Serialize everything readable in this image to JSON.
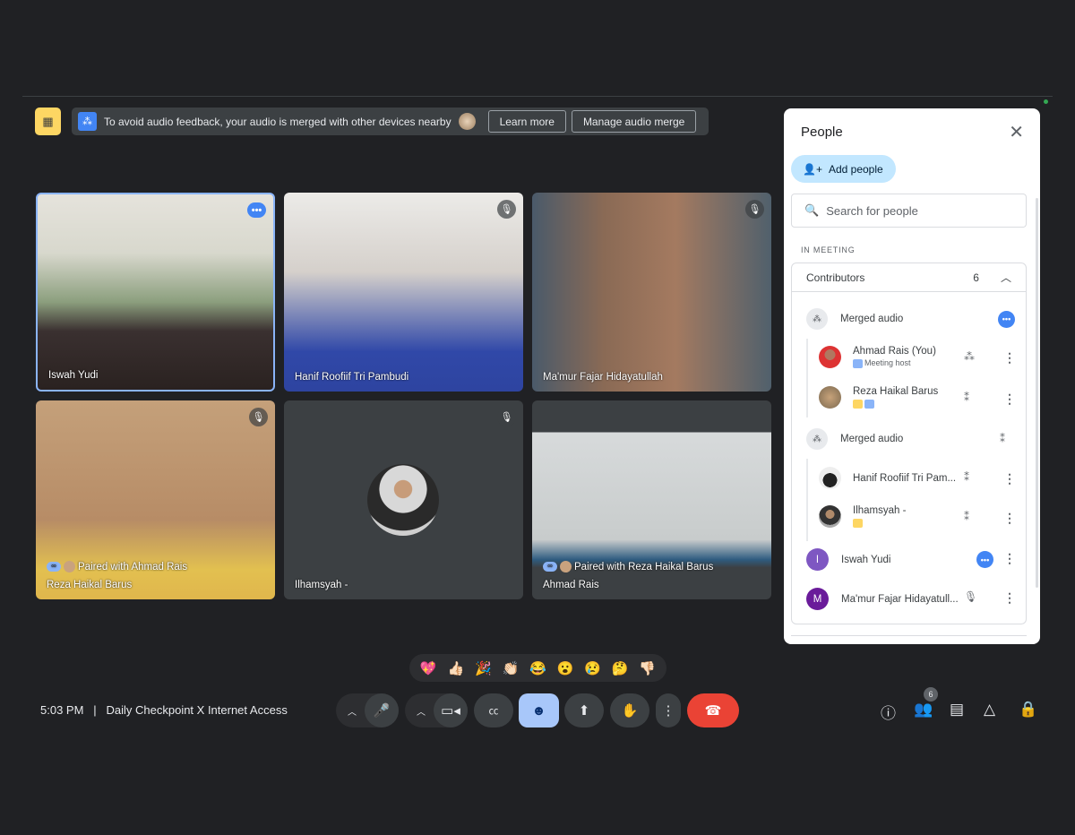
{
  "banner": {
    "message": "To avoid audio feedback, your audio is merged with other devices nearby",
    "learn_more": "Learn more",
    "manage": "Manage audio merge"
  },
  "tiles": [
    {
      "name": "Iswah Yudi",
      "status": "more-options",
      "bg": "#9aa58a"
    },
    {
      "name": "Hanif Roofiif Tri Pambudi",
      "status": "muted",
      "bg": "#c9c5c0"
    },
    {
      "name": "Ma'mur Fajar Hidayatullah",
      "status": "muted",
      "bg": "#5f6a78"
    },
    {
      "name": "Reza Haikal Barus",
      "pair": "Paired with Ahmad Rais",
      "status": "muted",
      "bg": "#c9a47e"
    },
    {
      "name": "Ilhamsyah -",
      "status": "muted",
      "bg": "#3c4043"
    },
    {
      "name": "Ahmad Rais",
      "pair": "Paired with Reza Haikal Barus",
      "status": "none",
      "bg": "#cfd3d3"
    }
  ],
  "panel": {
    "title": "People",
    "add_people": "Add people",
    "search_placeholder": "Search for people",
    "in_meeting": "IN MEETING",
    "contributors_label": "Contributors",
    "contributors_count": "6",
    "merged1": "Merged audio",
    "merged2": "Merged audio",
    "people": [
      {
        "name": "Ahmad Rais (You)",
        "sub": "Meeting host"
      },
      {
        "name": "Reza Haikal Barus"
      },
      {
        "name": "Hanif Roofiif Tri Pam..."
      },
      {
        "name": "Ilhamsyah -"
      },
      {
        "name": "Iswah Yudi",
        "initial": "I"
      },
      {
        "name": "Ma'mur Fajar Hidayatull...",
        "initial": "M"
      }
    ]
  },
  "reactions": [
    "💖",
    "👍🏻",
    "🎉",
    "👏🏻",
    "😂",
    "😮",
    "😢",
    "🤔",
    "👎🏻"
  ],
  "footer": {
    "time": "5:03 PM",
    "separator": "|",
    "meeting": "Daily Checkpoint X Internet Access",
    "people_count": "6"
  },
  "colors": {
    "accent": "#4285f4",
    "end_call": "#ea4335",
    "reactions_active": "#a8c7fa"
  }
}
